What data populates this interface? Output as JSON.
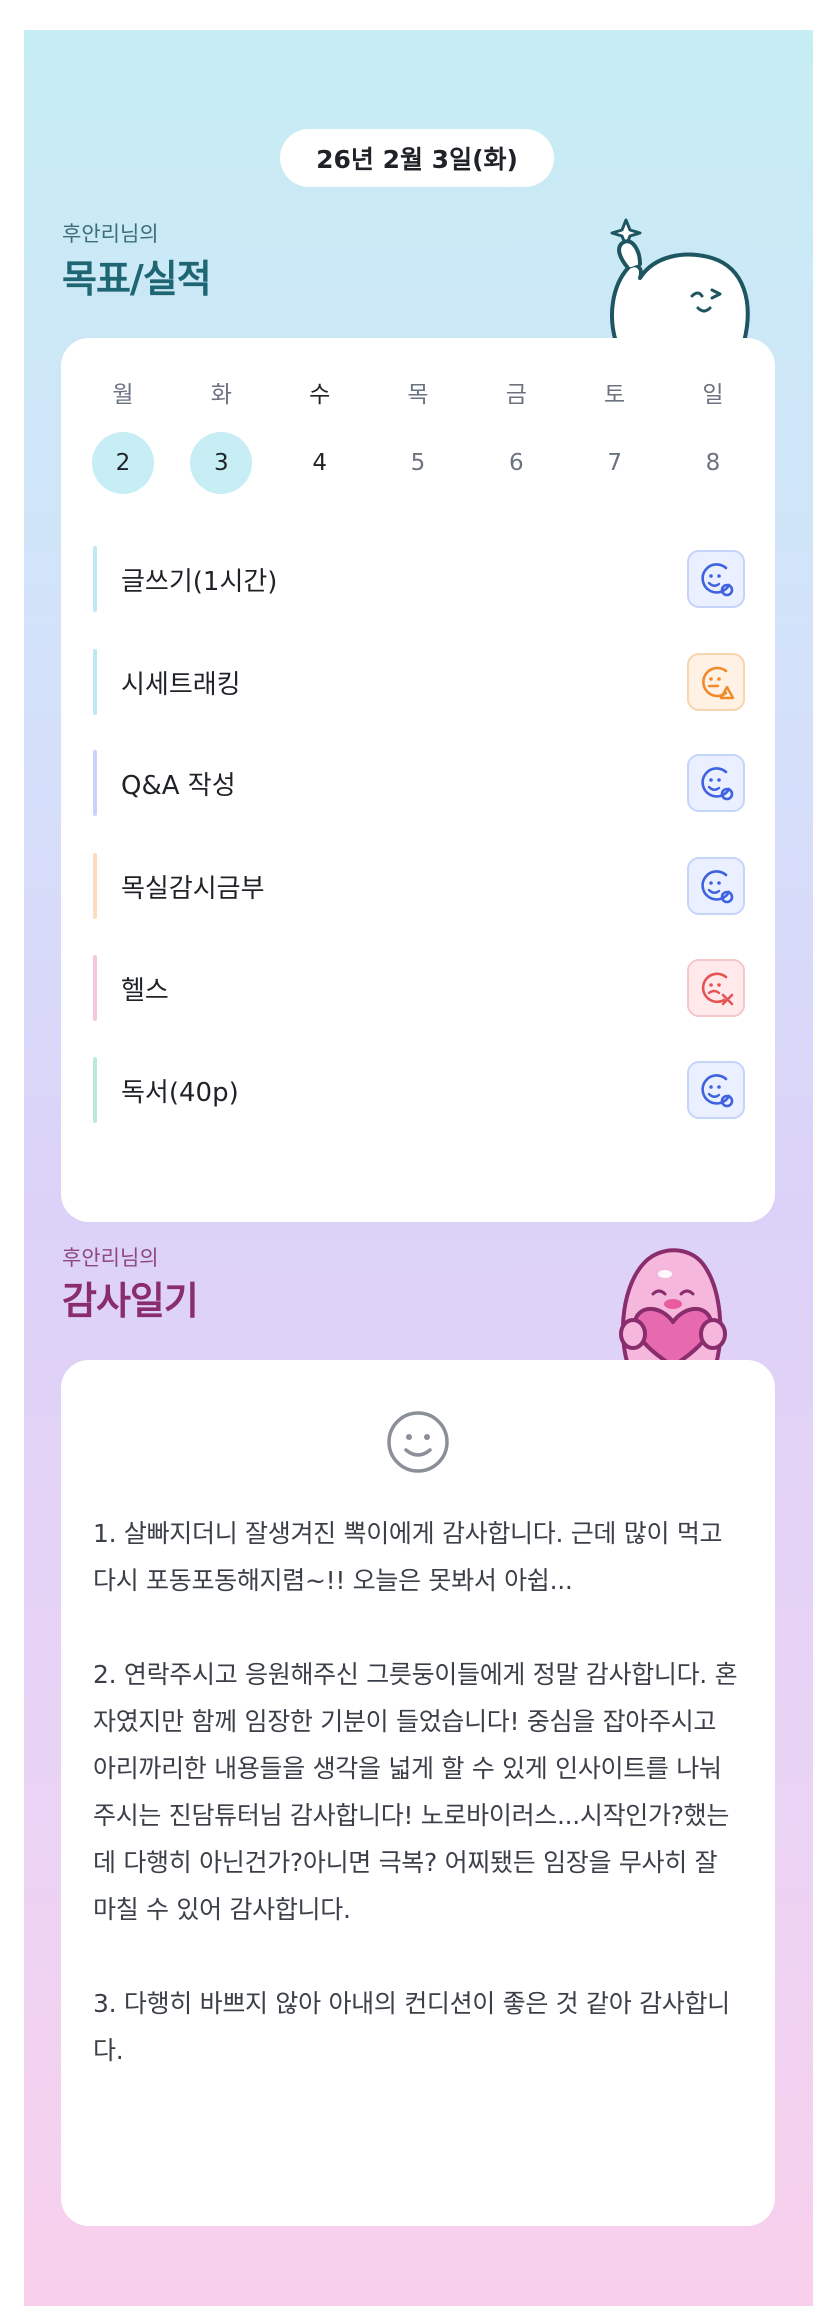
{
  "header": {
    "date": "26년 2월 3일(화)"
  },
  "goals": {
    "owner": "후안리님의",
    "title": "목표/실적",
    "week": [
      {
        "name": "월",
        "num": "2",
        "state": "done"
      },
      {
        "name": "화",
        "num": "3",
        "state": "done"
      },
      {
        "name": "수",
        "num": "4",
        "state": "today"
      },
      {
        "name": "목",
        "num": "5",
        "state": "future"
      },
      {
        "name": "금",
        "num": "6",
        "state": "future"
      },
      {
        "name": "토",
        "num": "7",
        "state": "future"
      },
      {
        "name": "일",
        "num": "8",
        "state": "future"
      }
    ],
    "items": [
      {
        "label": "글쓰기(1시간)",
        "status": "done",
        "bar_color": "#bfe8f2"
      },
      {
        "label": "시세트래킹",
        "status": "partial",
        "bar_color": "#bfe8f2"
      },
      {
        "label": "Q&A 작성",
        "status": "done",
        "bar_color": "#c9d3fb"
      },
      {
        "label": "목실감시금부",
        "status": "done",
        "bar_color": "#fbdcc0"
      },
      {
        "label": "헬스",
        "status": "failed",
        "bar_color": "#f6c6df"
      },
      {
        "label": "독서(40p)",
        "status": "done",
        "bar_color": "#bfe8dd"
      }
    ],
    "status_icons": {
      "done": "smile-check-icon",
      "partial": "smile-warning-icon",
      "failed": "smile-x-icon"
    },
    "colors": {
      "done": "#3f63e0",
      "partial": "#f08a2a",
      "failed": "#e45454"
    }
  },
  "diary": {
    "owner": "후안리님의",
    "title": "감사일기",
    "paragraphs": [
      "1. 살빠지더니 잘생겨진 뽁이에게 감사합니다. 근데 많이 먹고 다시 포동포동해지렴~!! 오늘은 못봐서 아쉽...",
      "2. 연락주시고 응원해주신 그릇둥이들에게 정말 감사합니다. 혼자였지만 함께 임장한 기분이 들었습니다! 중심을 잡아주시고 아리까리한 내용들을 생각을 넓게 할 수 있게 인사이트를 나눠주시는 진담튜터님 감사합니다! 노로바이러스...시작인가?했는데 다행히 아닌건가?아니면 극복? 어찌됐든 임장을 무사히 잘 마칠 수 있어 감사합니다.",
      "3. 다행히 바쁘지 않아 아내의 컨디션이 좋은 것 같아 감사합니다."
    ]
  }
}
